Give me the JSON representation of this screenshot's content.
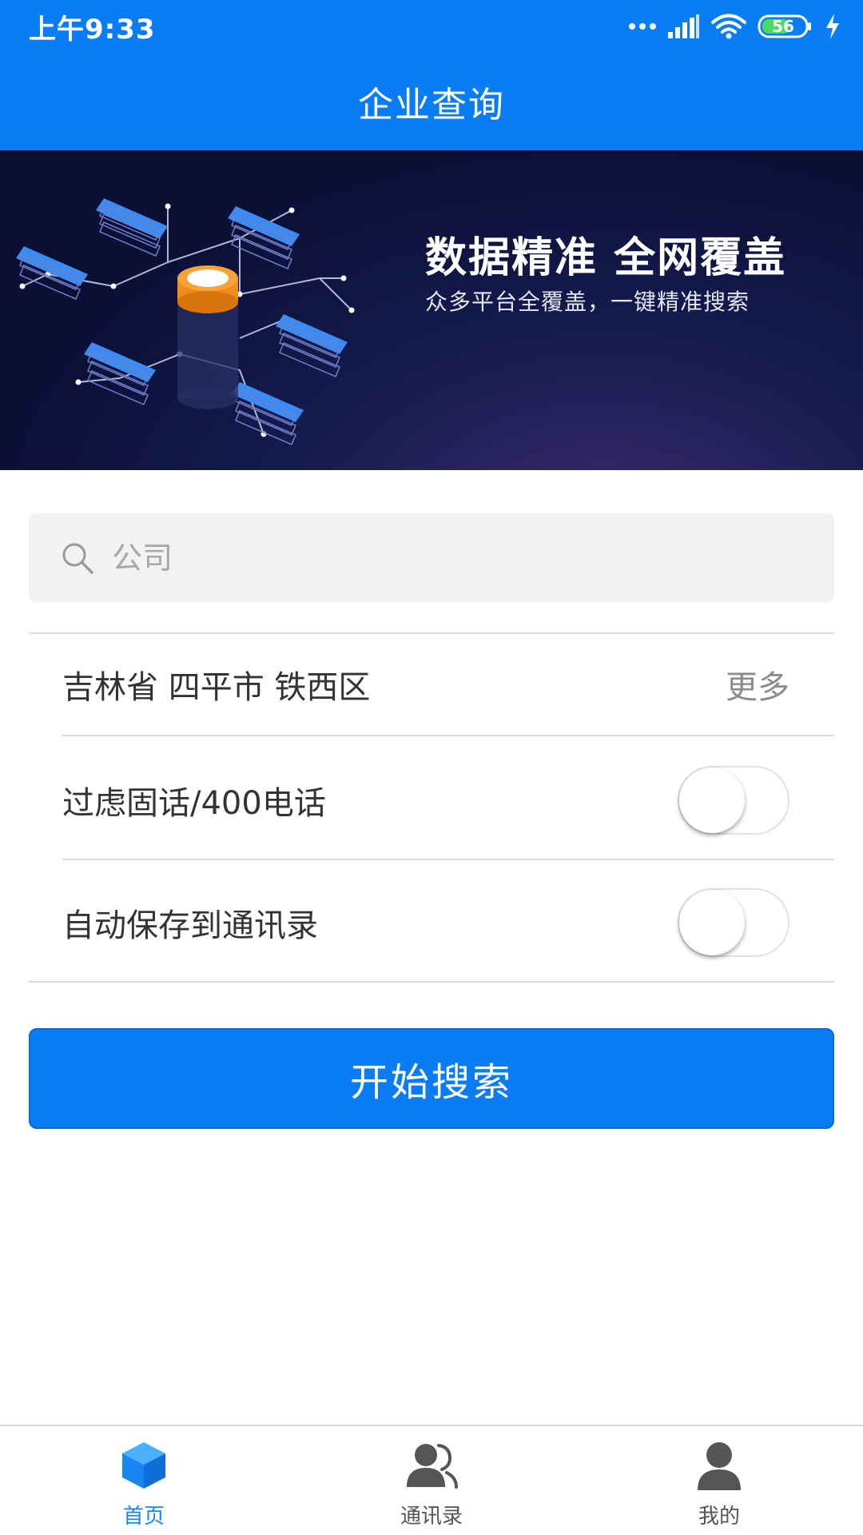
{
  "status_bar": {
    "time": "上午9:33",
    "battery_level": "56",
    "icons": [
      "signal-dots-icon",
      "cell-signal-icon",
      "wifi-icon",
      "battery-icon",
      "charging-icon"
    ]
  },
  "header": {
    "title": "企业查询"
  },
  "banner": {
    "headline": "数据精准 全网覆盖",
    "subline": "众多平台全覆盖，一键精准搜索"
  },
  "search": {
    "placeholder": "公司",
    "value": ""
  },
  "region": {
    "label": "吉林省 四平市 铁西区",
    "more_label": "更多"
  },
  "options": [
    {
      "label": "过虑固话/400电话",
      "enabled": false
    },
    {
      "label": "自动保存到通讯录",
      "enabled": false
    }
  ],
  "actions": {
    "start_label": "开始搜索"
  },
  "tabs": [
    {
      "label": "首页",
      "icon": "cube-icon",
      "active": true
    },
    {
      "label": "通讯录",
      "icon": "contacts-icon",
      "active": false
    },
    {
      "label": "我的",
      "icon": "person-icon",
      "active": false
    }
  ],
  "colors": {
    "primary": "#0a7cf5",
    "tab_active": "#1a86f4",
    "tab_inactive": "#555555",
    "banner_dark": "#0a0f33"
  }
}
